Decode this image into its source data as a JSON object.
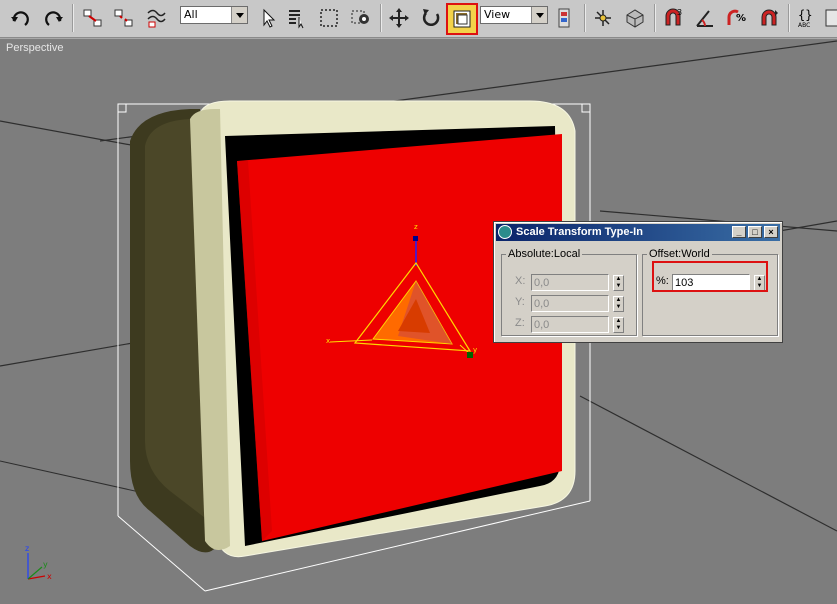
{
  "toolbar": {
    "selection_filter": "All",
    "reference_coordinate_system": "View",
    "icons": [
      "undo-icon",
      "redo-icon",
      "select-and-link-icon",
      "unlink-icon",
      "bind-to-space-warp-icon",
      "select-object-icon",
      "select-by-name-icon",
      "rectangular-selection-icon",
      "window-crossing-icon",
      "select-and-move-icon",
      "select-and-rotate-icon",
      "select-and-scale-icon",
      "pivot-center-icon",
      "select-and-manipulate-icon",
      "keyboard-shortcut-override-icon",
      "snaps-toggle-icon",
      "angle-snap-icon",
      "percent-snap-icon",
      "spinner-snap-icon",
      "edit-named-selections-icon"
    ],
    "snap_label": "3",
    "named_sel_label": "ABC"
  },
  "viewport": {
    "label": "Perspective",
    "axis_labels": {
      "x": "x",
      "y": "y",
      "z": "z"
    },
    "tripod_labels": {
      "x": "x",
      "y": "y",
      "z": "z"
    }
  },
  "dialog": {
    "title": "Scale Transform Type-In",
    "absolute_group": "Absolute:Local",
    "offset_group": "Offset:World",
    "fields": [
      {
        "label": "X:",
        "value": "0,0"
      },
      {
        "label": "Y:",
        "value": "0,0"
      },
      {
        "label": "Z:",
        "value": "0,0"
      }
    ],
    "percent_label": "%:",
    "percent_value": "103",
    "minimize": "_",
    "maximize": "□",
    "close": "×"
  }
}
